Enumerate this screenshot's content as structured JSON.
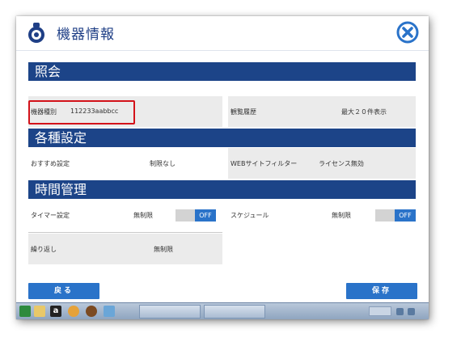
{
  "window": {
    "title": "機器情報"
  },
  "sections": {
    "inquiry": {
      "title": "照会",
      "device_type_label": "機器種別",
      "device_type_value": "112233aabbcc",
      "history_label": "観覧履歴",
      "history_value": "最大２０件表示"
    },
    "settings": {
      "title": "各種設定",
      "recommended_label": "おすすめ設定",
      "recommended_value": "制限なし",
      "web_filter_label": "WEBサイトフィルター",
      "web_filter_value": "ライセンス無効"
    },
    "time": {
      "title": "時間管理",
      "timer_label": "タイマー設定",
      "timer_value": "無制限",
      "timer_toggle": "OFF",
      "schedule_label": "スケジュール",
      "schedule_value": "無制限",
      "schedule_toggle": "OFF",
      "repeat_label": "繰り返し",
      "repeat_value": "無制限"
    }
  },
  "buttons": {
    "back": "戻る",
    "save": "保存"
  },
  "colors": {
    "header_blue": "#1c4488",
    "button_blue": "#2a73c9",
    "highlight_red": "#d3121a",
    "cell_gray": "#ebebeb"
  },
  "icons": {
    "title": "robot-vacuum-icon",
    "close": "close-circle-icon"
  }
}
